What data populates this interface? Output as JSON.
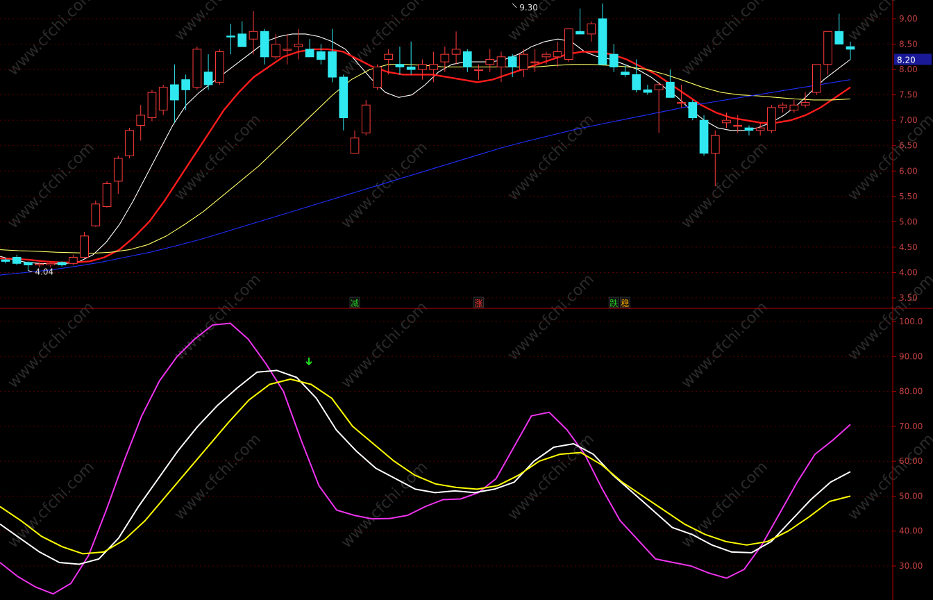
{
  "colors": {
    "background": "#000000",
    "grid": "#5a0000",
    "axis_line": "#b00000",
    "axis_text": "#c04040",
    "candle_up": "#ff3b3b",
    "candle_down": "#30e8f0",
    "ma_white": "#ffffff",
    "ma_red": "#ff1c1c",
    "ma_yellow": "#ffff66",
    "ma_blue": "#1f2fff",
    "osc_magenta": "#ee33ee",
    "osc_white": "#ffffff",
    "osc_yellow": "#ffff00",
    "current_price_box": "#1a1a99",
    "signal_arrow": "#22dd22"
  },
  "chart_data": [
    {
      "type": "candlestick",
      "panel": "price",
      "ylim": [
        3.4,
        9.3
      ],
      "y_ticks": [
        "9.00",
        "8.50",
        "8.00",
        "7.50",
        "7.00",
        "6.50",
        "6.00",
        "5.50",
        "5.00",
        "4.50",
        "4.00",
        "3.50"
      ],
      "current_price_label": "8.20",
      "current_price": 8.2,
      "annotations": [
        {
          "text": "9.30",
          "candle_index": 45,
          "price": 9.3
        },
        {
          "text": "4.04",
          "candle_index": 2,
          "price": 4.04
        }
      ],
      "signals": [
        {
          "text": "减",
          "candle_index": 31,
          "color": "#22cc22"
        },
        {
          "text": "涨",
          "candle_index": 42,
          "color": "#ff3333"
        },
        {
          "text": "跌",
          "candle_index": 54,
          "color": "#22cc22"
        },
        {
          "text": "稳",
          "candle_index": 55,
          "color": "#ffaa00"
        }
      ],
      "candles": [
        {
          "o": 4.25,
          "h": 4.3,
          "l": 4.18,
          "c": 4.22
        },
        {
          "o": 4.3,
          "h": 4.35,
          "l": 4.15,
          "c": 4.18
        },
        {
          "o": 4.2,
          "h": 4.22,
          "l": 4.04,
          "c": 4.15
        },
        {
          "o": 4.15,
          "h": 4.2,
          "l": 4.1,
          "c": 4.17
        },
        {
          "o": 4.15,
          "h": 4.22,
          "l": 4.1,
          "c": 4.18
        },
        {
          "o": 4.2,
          "h": 4.22,
          "l": 4.12,
          "c": 4.15
        },
        {
          "o": 4.18,
          "h": 4.35,
          "l": 4.15,
          "c": 4.3
        },
        {
          "o": 4.3,
          "h": 4.8,
          "l": 4.28,
          "c": 4.72
        },
        {
          "o": 4.92,
          "h": 5.42,
          "l": 4.9,
          "c": 5.35
        },
        {
          "o": 5.3,
          "h": 5.8,
          "l": 5.28,
          "c": 5.75
        },
        {
          "o": 5.8,
          "h": 6.3,
          "l": 5.55,
          "c": 6.25
        },
        {
          "o": 6.3,
          "h": 6.85,
          "l": 6.25,
          "c": 6.8
        },
        {
          "o": 6.9,
          "h": 7.3,
          "l": 6.6,
          "c": 7.1
        },
        {
          "o": 7.05,
          "h": 7.6,
          "l": 6.98,
          "c": 7.55
        },
        {
          "o": 7.2,
          "h": 7.7,
          "l": 7.1,
          "c": 7.65
        },
        {
          "o": 7.7,
          "h": 8.1,
          "l": 6.95,
          "c": 7.4
        },
        {
          "o": 7.8,
          "h": 7.9,
          "l": 7.2,
          "c": 7.6
        },
        {
          "o": 7.65,
          "h": 8.45,
          "l": 7.6,
          "c": 8.4
        },
        {
          "o": 7.95,
          "h": 8.3,
          "l": 7.6,
          "c": 7.7
        },
        {
          "o": 7.75,
          "h": 8.4,
          "l": 7.7,
          "c": 8.35
        },
        {
          "o": 8.66,
          "h": 8.9,
          "l": 8.3,
          "c": 8.65
        },
        {
          "o": 8.7,
          "h": 8.95,
          "l": 8.5,
          "c": 8.45
        },
        {
          "o": 8.6,
          "h": 9.15,
          "l": 8.3,
          "c": 8.75
        },
        {
          "o": 8.75,
          "h": 8.8,
          "l": 8.1,
          "c": 8.25
        },
        {
          "o": 8.25,
          "h": 8.7,
          "l": 8.2,
          "c": 8.5
        },
        {
          "o": 8.4,
          "h": 8.7,
          "l": 8.1,
          "c": 8.4
        },
        {
          "o": 8.45,
          "h": 8.8,
          "l": 8.2,
          "c": 8.5
        },
        {
          "o": 8.4,
          "h": 8.6,
          "l": 8.25,
          "c": 8.25
        },
        {
          "o": 8.35,
          "h": 8.5,
          "l": 8.1,
          "c": 8.2
        },
        {
          "o": 8.35,
          "h": 8.8,
          "l": 7.75,
          "c": 7.85
        },
        {
          "o": 7.85,
          "h": 7.9,
          "l": 6.8,
          "c": 7.05
        },
        {
          "o": 6.35,
          "h": 6.8,
          "l": 6.35,
          "c": 6.65
        },
        {
          "o": 6.75,
          "h": 7.4,
          "l": 6.7,
          "c": 7.3
        },
        {
          "o": 7.65,
          "h": 8.1,
          "l": 7.6,
          "c": 8.05
        },
        {
          "o": 8.2,
          "h": 8.4,
          "l": 7.9,
          "c": 8.3
        },
        {
          "o": 8.1,
          "h": 8.45,
          "l": 7.9,
          "c": 8.05
        },
        {
          "o": 8.05,
          "h": 8.55,
          "l": 7.9,
          "c": 8.0
        },
        {
          "o": 8.0,
          "h": 8.2,
          "l": 7.8,
          "c": 8.1
        },
        {
          "o": 8.0,
          "h": 8.35,
          "l": 7.75,
          "c": 8.1
        },
        {
          "o": 8.15,
          "h": 8.45,
          "l": 7.95,
          "c": 8.3
        },
        {
          "o": 8.3,
          "h": 8.75,
          "l": 8.1,
          "c": 8.4
        },
        {
          "o": 8.35,
          "h": 8.4,
          "l": 7.95,
          "c": 8.05
        },
        {
          "o": 8.0,
          "h": 8.1,
          "l": 7.8,
          "c": 8.0
        },
        {
          "o": 8.1,
          "h": 8.4,
          "l": 7.95,
          "c": 8.2
        },
        {
          "o": 8.05,
          "h": 8.35,
          "l": 7.75,
          "c": 8.25
        },
        {
          "o": 8.25,
          "h": 8.3,
          "l": 7.85,
          "c": 8.05
        },
        {
          "o": 8.0,
          "h": 8.4,
          "l": 7.85,
          "c": 8.3
        },
        {
          "o": 8.15,
          "h": 8.4,
          "l": 7.95,
          "c": 8.15
        },
        {
          "o": 8.25,
          "h": 8.35,
          "l": 8.1,
          "c": 8.3
        },
        {
          "o": 8.25,
          "h": 8.55,
          "l": 8.05,
          "c": 8.35
        },
        {
          "o": 8.2,
          "h": 8.8,
          "l": 8.15,
          "c": 8.8
        },
        {
          "o": 8.75,
          "h": 9.2,
          "l": 8.7,
          "c": 8.7
        },
        {
          "o": 8.7,
          "h": 8.95,
          "l": 8.55,
          "c": 8.9
        },
        {
          "o": 9.0,
          "h": 9.3,
          "l": 8.1,
          "c": 8.1
        },
        {
          "o": 8.3,
          "h": 8.5,
          "l": 7.95,
          "c": 8.05
        },
        {
          "o": 7.95,
          "h": 8.1,
          "l": 7.85,
          "c": 7.9
        },
        {
          "o": 7.9,
          "h": 8.2,
          "l": 7.55,
          "c": 7.6
        },
        {
          "o": 7.6,
          "h": 7.7,
          "l": 7.5,
          "c": 7.55
        },
        {
          "o": 7.6,
          "h": 7.75,
          "l": 6.75,
          "c": 7.7
        },
        {
          "o": 7.75,
          "h": 8.0,
          "l": 7.45,
          "c": 7.45
        },
        {
          "o": 7.35,
          "h": 7.7,
          "l": 7.25,
          "c": 7.35
        },
        {
          "o": 7.35,
          "h": 7.4,
          "l": 7.0,
          "c": 7.05
        },
        {
          "o": 7.0,
          "h": 7.1,
          "l": 6.3,
          "c": 6.35
        },
        {
          "o": 6.35,
          "h": 6.8,
          "l": 5.7,
          "c": 6.7
        },
        {
          "o": 6.95,
          "h": 7.15,
          "l": 6.85,
          "c": 7.0
        },
        {
          "o": 6.9,
          "h": 7.1,
          "l": 6.75,
          "c": 6.9
        },
        {
          "o": 6.85,
          "h": 6.9,
          "l": 6.7,
          "c": 6.8
        },
        {
          "o": 6.8,
          "h": 6.95,
          "l": 6.7,
          "c": 6.85
        },
        {
          "o": 6.8,
          "h": 7.3,
          "l": 6.75,
          "c": 7.25
        },
        {
          "o": 7.25,
          "h": 7.35,
          "l": 7.15,
          "c": 7.3
        },
        {
          "o": 7.2,
          "h": 7.4,
          "l": 7.15,
          "c": 7.3
        },
        {
          "o": 7.3,
          "h": 7.55,
          "l": 7.25,
          "c": 7.35
        },
        {
          "o": 7.55,
          "h": 8.1,
          "l": 7.5,
          "c": 8.1
        },
        {
          "o": 8.1,
          "h": 8.75,
          "l": 7.9,
          "c": 8.75
        },
        {
          "o": 8.75,
          "h": 9.1,
          "l": 8.5,
          "c": 8.5
        },
        {
          "o": 8.45,
          "h": 8.55,
          "l": 8.2,
          "c": 8.4
        }
      ],
      "series": [
        {
          "color_key": "ma_white",
          "values": [
            4.32,
            4.25,
            4.2,
            4.18,
            4.17,
            4.18,
            4.22,
            4.35,
            4.6,
            4.95,
            5.4,
            5.9,
            6.4,
            6.9,
            7.3,
            7.55,
            7.75,
            7.95,
            8.15,
            8.35,
            8.55,
            8.65,
            8.7,
            8.7,
            8.65,
            8.55,
            8.4,
            8.1,
            7.8,
            7.55,
            7.45,
            7.5,
            7.7,
            7.95,
            8.1,
            8.15,
            8.15,
            8.15,
            8.2,
            8.3,
            8.45,
            8.55,
            8.6,
            8.55,
            8.35,
            8.25,
            8.2,
            8.1,
            8.0,
            7.85,
            7.65,
            7.45,
            7.2,
            7.0,
            6.85,
            6.8,
            6.8,
            6.85,
            6.95,
            7.1,
            7.3,
            7.55,
            7.8,
            8.0,
            8.2
          ]
        },
        {
          "color_key": "ma_red",
          "values": [
            4.28,
            4.27,
            4.25,
            4.22,
            4.2,
            4.2,
            4.22,
            4.3,
            4.45,
            4.7,
            5.0,
            5.4,
            5.85,
            6.3,
            6.75,
            7.2,
            7.55,
            7.85,
            8.05,
            8.25,
            8.35,
            8.4,
            8.4,
            8.35,
            8.2,
            8.05,
            7.95,
            7.9,
            7.9,
            7.9,
            7.85,
            7.8,
            7.75,
            7.8,
            7.9,
            8.0,
            8.1,
            8.2,
            8.3,
            8.35,
            8.35,
            8.3,
            8.2,
            8.05,
            7.9,
            7.7,
            7.5,
            7.3,
            7.15,
            7.05,
            7.0,
            6.95,
            6.95,
            7.0,
            7.1,
            7.25,
            7.45,
            7.65
          ]
        },
        {
          "color_key": "ma_yellow",
          "values": [
            4.45,
            4.43,
            4.42,
            4.4,
            4.39,
            4.38,
            4.4,
            4.45,
            4.55,
            4.72,
            4.95,
            5.2,
            5.5,
            5.8,
            6.1,
            6.45,
            6.8,
            7.15,
            7.5,
            7.8,
            8.0,
            8.1,
            8.1,
            8.08,
            8.05,
            8.05,
            8.05,
            8.05,
            8.05,
            8.05,
            8.08,
            8.1,
            8.1,
            8.08,
            8.05,
            8.0,
            7.9,
            7.78,
            7.65,
            7.55,
            7.5,
            7.48,
            7.45,
            7.42,
            7.4,
            7.4,
            7.42
          ]
        },
        {
          "color_key": "ma_blue",
          "values": [
            3.95,
            4.0,
            4.05,
            4.12,
            4.2,
            4.3,
            4.4,
            4.52,
            4.65,
            4.8,
            4.95,
            5.1,
            5.25,
            5.4,
            5.55,
            5.7,
            5.85,
            6.0,
            6.15,
            6.3,
            6.45,
            6.58,
            6.7,
            6.82,
            6.92,
            7.02,
            7.12,
            7.22,
            7.32,
            7.4,
            7.48,
            7.56,
            7.64,
            7.72,
            7.8
          ]
        }
      ]
    },
    {
      "type": "line",
      "panel": "oscillator",
      "ylim": [
        26,
        102
      ],
      "y_ticks": [
        "100.0",
        "90.00",
        "80.00",
        "70.00",
        "60.00",
        "50.00",
        "40.00",
        "30.00"
      ],
      "signals": [
        {
          "type": "down-arrow",
          "x_index": 22,
          "value": 86.5
        }
      ],
      "series": [
        {
          "color_key": "osc_magenta",
          "values": [
            31,
            27,
            24,
            22,
            25,
            33,
            46,
            60,
            73,
            83,
            90,
            95,
            99,
            99.5,
            95,
            88,
            80,
            66,
            53,
            46,
            44.5,
            43.5,
            43.6,
            44.5,
            47,
            49,
            49.2,
            51,
            55,
            64,
            73,
            74,
            69,
            62,
            52,
            43,
            37.5,
            32,
            31,
            30,
            28,
            26.5,
            29,
            36,
            45,
            54,
            62,
            66,
            70.5
          ]
        },
        {
          "color_key": "osc_white",
          "values": [
            42,
            38,
            34,
            31,
            30.5,
            32,
            38,
            47,
            55,
            63,
            70,
            76,
            81,
            85.5,
            86,
            84,
            78,
            69,
            63,
            58,
            55,
            52,
            51,
            51.5,
            51,
            52,
            54,
            60,
            64,
            65,
            62,
            56,
            51,
            46,
            41,
            39,
            36,
            34,
            33.8,
            37,
            43,
            49,
            54,
            57
          ]
        },
        {
          "color_key": "osc_yellow",
          "values": [
            47,
            43,
            38.5,
            35.5,
            33.5,
            34,
            37.5,
            43,
            50,
            57,
            64,
            71,
            77.5,
            82,
            83.5,
            82,
            78,
            70,
            65,
            60,
            56,
            53.5,
            52.5,
            52,
            53,
            56,
            60,
            62,
            62.5,
            59,
            54,
            50,
            46,
            42,
            39,
            37,
            36,
            37,
            40,
            44,
            48.5,
            50
          ]
        }
      ]
    }
  ],
  "watermark": "www.cfchi.com"
}
